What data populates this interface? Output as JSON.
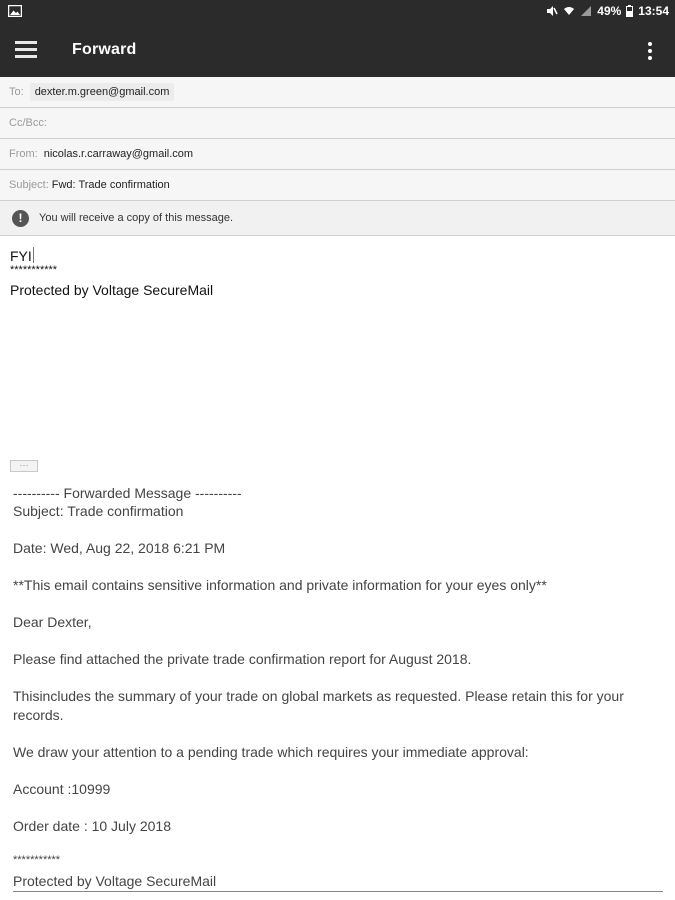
{
  "status_bar": {
    "battery": "49%",
    "time": "13:54",
    "icons": [
      "photo-icon",
      "mute-icon",
      "wifi-icon",
      "signal-icon",
      "battery-icon"
    ]
  },
  "app_bar": {
    "title": "Forward",
    "icons": [
      "menu-icon",
      "overflow-menu-icon"
    ]
  },
  "fields": {
    "to_label": "To:",
    "to_value": "dexter.m.green@gmail.com",
    "cc_label": "Cc/Bcc:",
    "from_label": "From:",
    "from_value": "nicolas.r.carraway@gmail.com",
    "subject_label": "Subject:",
    "subject_value": "Fwd: Trade confirmation"
  },
  "notice": {
    "icon": "exclamation-icon",
    "text": "You will receive a copy of this message."
  },
  "compose": {
    "text": "FYI",
    "stars": "***********",
    "signature": "Protected by Voltage SecureMail"
  },
  "expand_button": "···",
  "quoted": {
    "forward_header": "---------- Forwarded Message ----------",
    "subject": "Subject: Trade confirmation",
    "date": "Date: Wed, Aug 22, 2018 6:21 PM",
    "warning": "**This  email  contains sensitive  information and private  information for  your  eyes only**",
    "greeting": "Dear Dexter,",
    "para1": "Please find attached the private trade confirmation report for August  2018.",
    "para2": "Thisincludes the summary of your trade on global markets as requested. Please retain this for your records.",
    "para3": "We draw your attention to a pending trade which requires your immediate approval:",
    "account": "Account :10999",
    "order_date": "Order date : 10 July 2018",
    "stars": "***********",
    "signature": "Protected by Voltage SecureMail"
  }
}
